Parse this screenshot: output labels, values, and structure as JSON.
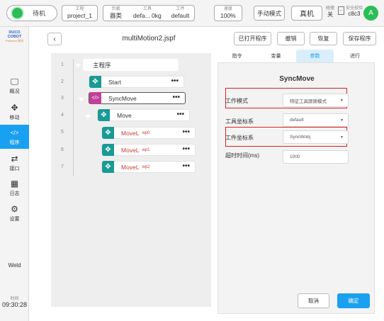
{
  "topbar": {
    "status": "待机",
    "info": [
      {
        "label": "工程",
        "value": "project_1"
      },
      {
        "label": "负载",
        "value": "器类"
      },
      {
        "label": "工具",
        "value": "defa...  0kg"
      },
      {
        "label": "工件",
        "value": "default"
      },
      {
        "label": "速度",
        "value": "100%"
      }
    ],
    "manual_mode": "手动模式",
    "real_machine": "真机",
    "link_label": "碰撞",
    "link_value": "关",
    "safety_label": "安全校验",
    "safety_value": "c8c3",
    "avatar": "A"
  },
  "sidebar": {
    "logo_line1": "DUCO COBOT",
    "logo_line2": "Premium 系列",
    "items": [
      {
        "label": "概况",
        "icon": "monitor-icon"
      },
      {
        "label": "移动",
        "icon": "move-icon"
      },
      {
        "label": "程序",
        "icon": "code-icon"
      },
      {
        "label": "接口",
        "icon": "interface-icon"
      },
      {
        "label": "日志",
        "icon": "calendar-icon"
      },
      {
        "label": "设置",
        "icon": "gear-icon"
      }
    ],
    "weld": "Weld",
    "time_label": "时间",
    "time_value": "09:30:28"
  },
  "header": {
    "back": "‹",
    "program_name": "multiMotion2.jspf",
    "buttons": [
      "已打开程序",
      "撤销",
      "恢复",
      "保存程序"
    ]
  },
  "tree": {
    "line_numbers": [
      "1",
      "2",
      "3",
      "4",
      "5",
      "6",
      "7"
    ],
    "nodes": [
      {
        "label": "主程序"
      },
      {
        "label": "Start",
        "dots": "•••"
      },
      {
        "label": "SyncMove",
        "dots": "•••"
      },
      {
        "label": "Move",
        "dots": "•••"
      },
      {
        "label": "MoveL",
        "sub": "wp0",
        "dots": "•••"
      },
      {
        "label": "MoveL",
        "sub": "wp1",
        "dots": "•••"
      },
      {
        "label": "MoveL",
        "sub": "wp2",
        "dots": "•••"
      }
    ]
  },
  "tabs": [
    "指令",
    "变量",
    "参数",
    "进行"
  ],
  "panel": {
    "title": "SyncMove",
    "rows": [
      {
        "label": "工作模式",
        "value": "特征工具跟随模式",
        "type": "select"
      },
      {
        "label": "工具坐标系",
        "value": "default",
        "type": "select"
      },
      {
        "label": "工件坐标系",
        "value": "SyncWobj",
        "type": "select"
      },
      {
        "label": "超时时间(ms)",
        "value": "1000",
        "type": "input"
      }
    ],
    "cancel": "取消",
    "ok": "确定"
  },
  "colors": {
    "accent": "#1aa0f0",
    "status": "#2bbd58",
    "node_teal": "#1a9a94",
    "node_magenta": "#c2409a",
    "highlight": "#e02020"
  }
}
